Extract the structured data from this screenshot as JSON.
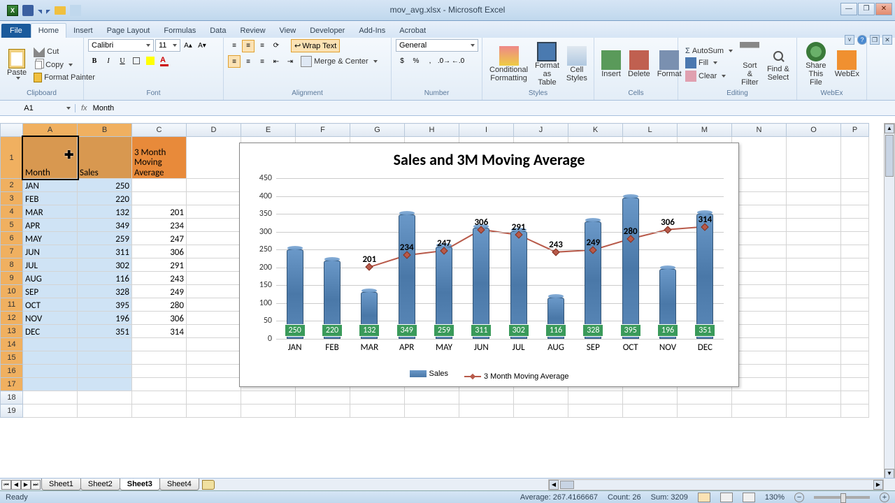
{
  "window": {
    "title": "mov_avg.xlsx - Microsoft Excel"
  },
  "tabs": {
    "file": "File",
    "home": "Home",
    "insert": "Insert",
    "page": "Page Layout",
    "formulas": "Formulas",
    "data": "Data",
    "review": "Review",
    "view": "View",
    "developer": "Developer",
    "addins": "Add-Ins",
    "acrobat": "Acrobat"
  },
  "ribbon": {
    "clipboard": {
      "label": "Clipboard",
      "paste": "Paste",
      "cut": "Cut",
      "copy": "Copy",
      "fmt": "Format Painter"
    },
    "font": {
      "label": "Font",
      "name": "Calibri",
      "size": "11"
    },
    "alignment": {
      "label": "Alignment",
      "wrap": "Wrap Text",
      "merge": "Merge & Center"
    },
    "number": {
      "label": "Number",
      "fmt": "General"
    },
    "styles": {
      "label": "Styles",
      "cond": "Conditional Formatting",
      "table": "Format as Table",
      "cell": "Cell Styles"
    },
    "cells": {
      "label": "Cells",
      "ins": "Insert",
      "del": "Delete",
      "fmt": "Format"
    },
    "editing": {
      "label": "Editing",
      "sum": "AutoSum",
      "fill": "Fill",
      "clear": "Clear",
      "sort": "Sort & Filter",
      "find": "Find & Select"
    },
    "webex": {
      "label": "WebEx",
      "share": "Share This File",
      "wbx": "WebEx"
    }
  },
  "namebox": "A1",
  "formula": "Month",
  "columns": [
    "A",
    "B",
    "C",
    "D",
    "E",
    "F",
    "G",
    "H",
    "I",
    "J",
    "K",
    "L",
    "M",
    "N",
    "O",
    "P"
  ],
  "headers": {
    "a": "Month",
    "b": "Sales",
    "c": "3 Month Moving Average"
  },
  "rows": [
    {
      "m": "JAN",
      "s": 250,
      "a": ""
    },
    {
      "m": "FEB",
      "s": 220,
      "a": ""
    },
    {
      "m": "MAR",
      "s": 132,
      "a": 201
    },
    {
      "m": "APR",
      "s": 349,
      "a": 234
    },
    {
      "m": "MAY",
      "s": 259,
      "a": 247
    },
    {
      "m": "JUN",
      "s": 311,
      "a": 306
    },
    {
      "m": "JUL",
      "s": 302,
      "a": 291
    },
    {
      "m": "AUG",
      "s": 116,
      "a": 243
    },
    {
      "m": "SEP",
      "s": 328,
      "a": 249
    },
    {
      "m": "OCT",
      "s": 395,
      "a": 280
    },
    {
      "m": "NOV",
      "s": 196,
      "a": 306
    },
    {
      "m": "DEC",
      "s": 351,
      "a": 314
    }
  ],
  "chart_data": {
    "type": "bar+line",
    "title": "Sales and 3M Moving Average",
    "categories": [
      "JAN",
      "FEB",
      "MAR",
      "APR",
      "MAY",
      "JUN",
      "JUL",
      "AUG",
      "SEP",
      "OCT",
      "NOV",
      "DEC"
    ],
    "series": [
      {
        "name": "Sales",
        "type": "bar",
        "values": [
          250,
          220,
          132,
          349,
          259,
          311,
          302,
          116,
          328,
          395,
          196,
          351
        ]
      },
      {
        "name": "3 Month Moving Average",
        "type": "line",
        "values": [
          null,
          null,
          201,
          234,
          247,
          306,
          291,
          243,
          249,
          280,
          306,
          314
        ]
      }
    ],
    "ylim": [
      0,
      450
    ],
    "y_ticks": [
      0,
      50,
      100,
      150,
      200,
      250,
      300,
      350,
      400,
      450
    ],
    "xlabel": "",
    "ylabel": ""
  },
  "sheets": [
    "Sheet1",
    "Sheet2",
    "Sheet3",
    "Sheet4"
  ],
  "active_sheet": 2,
  "status": {
    "ready": "Ready",
    "avg": "Average: 267.4166667",
    "count": "Count: 26",
    "sum": "Sum: 3209",
    "zoom": "130%"
  }
}
